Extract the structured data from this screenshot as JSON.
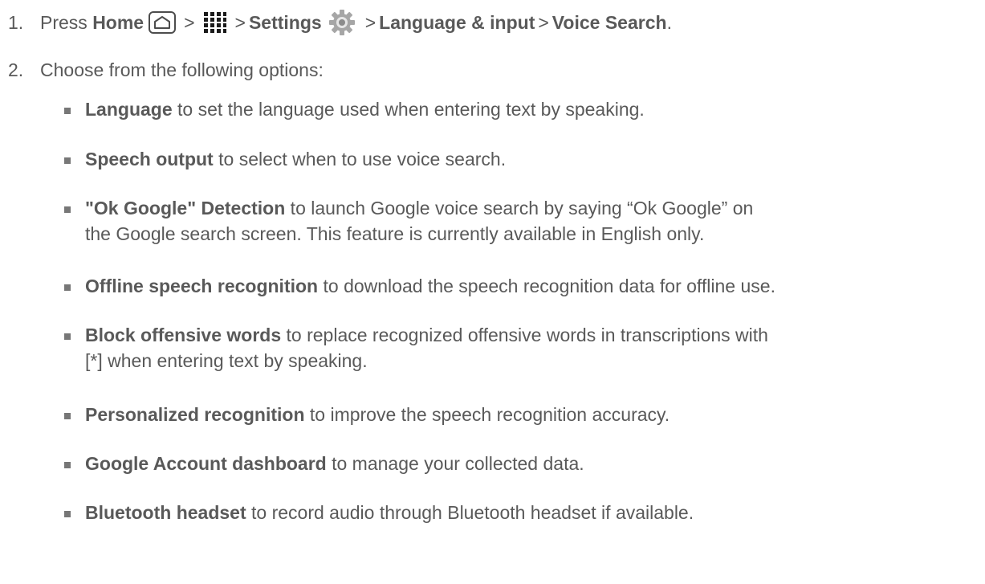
{
  "steps": [
    {
      "num": "1.",
      "parts": {
        "press": "Press",
        "home": "Home",
        "gt1": ">",
        "gt2": ">",
        "settings": "Settings",
        "gt3": ">",
        "language_input": "Language & input",
        "gt4": ">",
        "voice_search": "Voice Search",
        "period": "."
      },
      "icons": [
        "home-icon",
        "apps-icon",
        "gear-icon"
      ]
    },
    {
      "num": "2.",
      "text": "Choose from the following options:"
    }
  ],
  "options": [
    {
      "bold": "Language",
      "lines": [
        " to set the language used when entering text by speaking."
      ]
    },
    {
      "bold": "Speech output",
      "lines": [
        " to select when to use voice search."
      ]
    },
    {
      "bold": "\"Ok Google\" Detection",
      "lines": [
        " to launch Google voice search by saying “Ok Google” on",
        "the Google search screen. This feature is currently available in English only."
      ]
    },
    {
      "bold": "Offline speech recognition",
      "lines": [
        " to download the speech recognition data for offline use."
      ]
    },
    {
      "bold": "Block offensive words",
      "lines": [
        " to replace recognized offensive words in transcriptions with",
        "[*] when entering text by speaking."
      ]
    },
    {
      "bold": "Personalized recognition",
      "lines": [
        " to improve the speech recognition accuracy."
      ]
    },
    {
      "bold": "Google Account dashboard",
      "lines": [
        " to manage your collected data."
      ]
    },
    {
      "bold": "Bluetooth headset",
      "lines": [
        " to record audio through Bluetooth headset if available."
      ]
    }
  ],
  "colors": {
    "text": "#595959",
    "bullet": "#777777",
    "icon_gear": "#a6a6a6"
  }
}
